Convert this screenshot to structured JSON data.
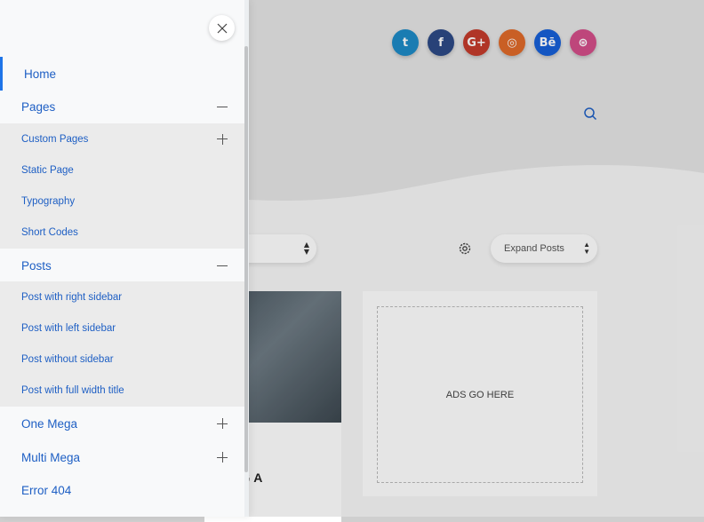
{
  "social_icons": [
    {
      "name": "twitter-icon",
      "glyph": "t",
      "color": "#1d8bc7"
    },
    {
      "name": "facebook-icon",
      "glyph": "f",
      "color": "#2d4a86"
    },
    {
      "name": "google-plus-icon",
      "glyph": "G+",
      "color": "#c43c2c"
    },
    {
      "name": "instagram-icon",
      "glyph": "◎",
      "color": "#e06a2a"
    },
    {
      "name": "behance-icon",
      "glyph": "Bē",
      "color": "#1760d8"
    },
    {
      "name": "dribbble-icon",
      "glyph": "⊛",
      "color": "#d44e8a"
    }
  ],
  "toolbar": {
    "expand_select": "Expand Posts"
  },
  "post": {
    "title_fragment": "NG A"
  },
  "ads": {
    "label": "ADS GO HERE"
  },
  "menu": {
    "home": "Home",
    "pages": "Pages",
    "pages_sub": [
      "Custom Pages",
      "Static Page",
      "Typography",
      "Short Codes"
    ],
    "posts": "Posts",
    "posts_sub": [
      "Post with right sidebar",
      "Post with left sidebar",
      "Post without sidebar",
      "Post with full width title"
    ],
    "one_mega": "One Mega",
    "multi_mega": "Multi Mega",
    "error_404": "Error 404"
  },
  "colors": {
    "menu_link": "#1e5fc4",
    "active_bar": "#1e74e8",
    "submenu_bg": "#ebebeb"
  }
}
